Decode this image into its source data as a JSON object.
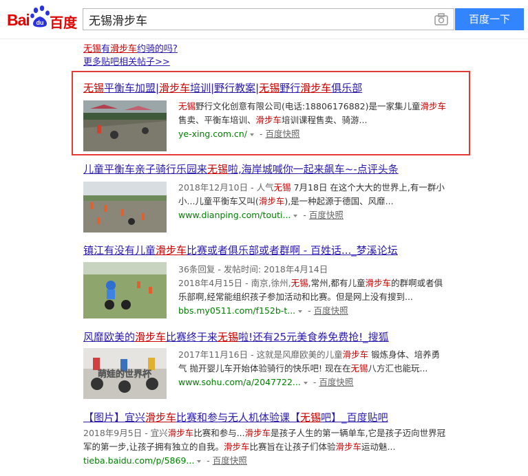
{
  "header": {
    "logo_text_left": "Bai",
    "logo_text_du": "du",
    "logo_text_right": "百度",
    "query": "无锡滑步车",
    "search_button": "百度一下"
  },
  "top": {
    "line1_em1": "无锡",
    "line1_mid": "有",
    "line1_em2": "滑步车",
    "line1_rest": "约骑的吗?",
    "more_link": "更多贴吧相关帖子>>"
  },
  "results": [
    {
      "title_parts": [
        "无锡",
        "平衡车加盟|",
        "滑步车",
        "培训|野行教案|",
        "无锡",
        "野行",
        "滑步车",
        "俱乐部"
      ],
      "line1": [
        "无锡",
        "野行文化创意有限公司(电话:18806176882)是一家集儿童",
        "滑步车"
      ],
      "line2": [
        "售卖、平衡车培训、",
        "滑步车",
        "培训课程售卖、骑游..."
      ],
      "url": "ye-xing.com.cn/",
      "snapshot": "百度快照"
    },
    {
      "title_parts": [
        "儿童平衡车亲子骑行乐园来",
        "无锡",
        "啦,海岸城喊你一起来飙车~-点评头条"
      ],
      "line1": [
        "2018年12月10日 - 人气",
        "无锡",
        " 7月18日 在这个大大的世界上,有一群小"
      ],
      "line2": [
        "小...儿童平衡车又叫(",
        "滑步车",
        "),是一种起源于德国、风靡..."
      ],
      "url": "www.dianping.com/touti...",
      "snapshot": "百度快照"
    },
    {
      "title_parts": [
        "镇江有没有儿童",
        "滑步车",
        "比赛或者俱乐部或者群啊 - 百姓话..._梦溪论坛"
      ],
      "meta": "36条回复 - 发帖时间: 2018年4月14日",
      "line1": [
        "2018年4月15日 - 南京,徐州,",
        "无锡",
        ",常州,都有儿童",
        "滑步车",
        "的群啊或者俱"
      ],
      "line2": [
        "乐部啊,经常能组织孩子参加活动和比赛。但是网上没有搜到..."
      ],
      "url": "bbs.my0511.com/f152b-t...",
      "snapshot": "百度快照"
    },
    {
      "title_parts": [
        "风靡欧美的",
        "滑步车",
        "比赛终于来",
        "无锡",
        "啦!还有25元美食券免费抢!_搜狐"
      ],
      "line1": [
        "2017年11月16日 - 这就是风靡欧美的儿童",
        "滑步车",
        " 锻炼身体、培养勇"
      ],
      "line2": [
        "气 抛开婴儿车开始体验骑行的快乐吧! 现在在",
        "无锡",
        "八方汇也能玩..."
      ],
      "url": "www.sohu.com/a/2047722...",
      "snapshot": "百度快照",
      "thumb_text": "萌娃的世界杯"
    },
    {
      "title_parts": [
        "【图片】宜兴",
        "滑步车",
        "比赛和参与无人机体验课【",
        "无锡",
        "吧】_百度贴吧"
      ],
      "line1": [
        "2018年9月5日 - 宜兴",
        "滑步车",
        "比赛和参与...",
        "滑步车",
        "是孩子人生的第一辆单车,它是孩子迈向世界冠"
      ],
      "line2": [
        "军的第一步,让孩子拥有独立的自我。",
        "滑步车",
        "比赛旨在让孩子们体验",
        "滑步车",
        "运动魅..."
      ],
      "url": "tieba.baidu.com/p/5869...",
      "snapshot": "百度快照"
    }
  ],
  "colors": {
    "accent_blue": "#3385ff",
    "link": "#2b1bb0",
    "em_red": "#cc0000",
    "url_green": "#008000",
    "highlight_border": "#e53935"
  },
  "icons": [
    "baidu-paw-logo",
    "camera-icon",
    "dropdown-arrow-icon"
  ]
}
